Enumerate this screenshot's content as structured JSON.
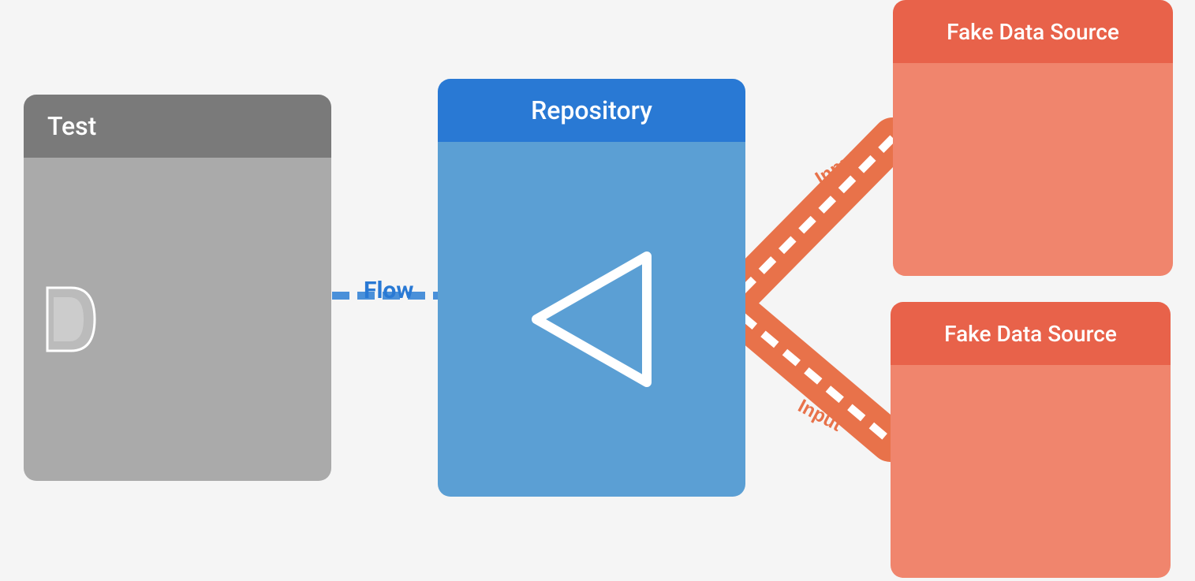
{
  "nodes": {
    "test": {
      "title": "Test"
    },
    "repository": {
      "title": "Repository"
    },
    "fakeDataSource1": {
      "title": "Fake Data Source",
      "inputLabel": "Input"
    },
    "fakeDataSource2": {
      "title": "Fake Data Source",
      "inputLabel": "Input"
    }
  },
  "flow": {
    "label": "Flow"
  },
  "colors": {
    "test_header": "#7a7a7a",
    "test_body": "#aaaaaa",
    "repo_header": "#2979d4",
    "repo_body": "#5b9fd4",
    "fds_header": "#e8624a",
    "fds_body": "#f0856d",
    "flow_line": "#4a90d9",
    "input_line": "#e8724a",
    "white": "#ffffff"
  }
}
